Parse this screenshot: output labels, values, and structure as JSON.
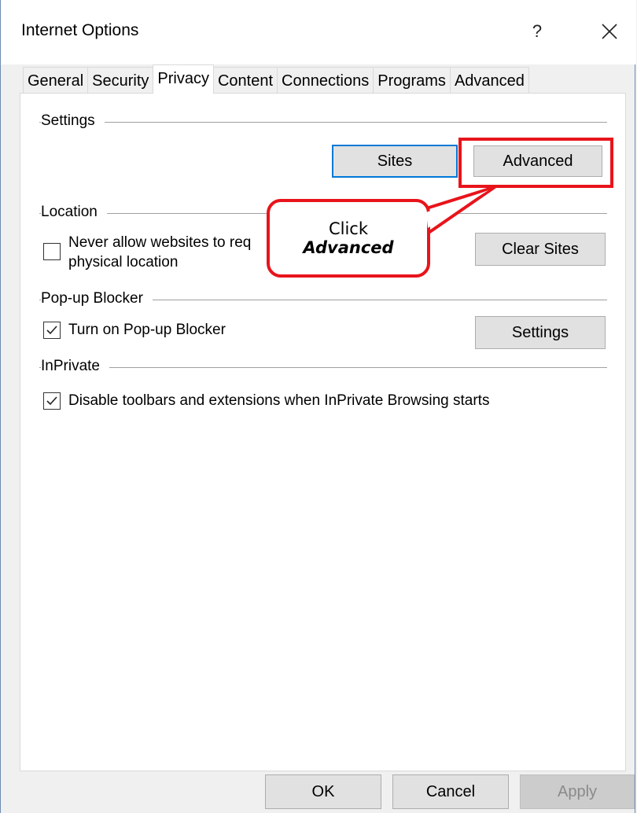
{
  "window": {
    "title": "Internet Options",
    "help_glyph": "?",
    "close_icon": "close-icon"
  },
  "tabs": [
    {
      "label": "General",
      "active": false
    },
    {
      "label": "Security",
      "active": false
    },
    {
      "label": "Privacy",
      "active": true
    },
    {
      "label": "Content",
      "active": false
    },
    {
      "label": "Connections",
      "active": false
    },
    {
      "label": "Programs",
      "active": false
    },
    {
      "label": "Advanced",
      "active": false
    }
  ],
  "settings": {
    "group_label": "Settings",
    "sites_button": "Sites",
    "advanced_button": "Advanced"
  },
  "location": {
    "group_label": "Location",
    "checkbox_line1": "Never allow websites to req",
    "checkbox_line2": "physical location",
    "checked": false,
    "clear_sites_button": "Clear Sites"
  },
  "popup": {
    "group_label": "Pop-up Blocker",
    "checkbox_label": "Turn on Pop-up Blocker",
    "checked": true,
    "settings_button": "Settings"
  },
  "inprivate": {
    "group_label": "InPrivate",
    "checkbox_label": "Disable toolbars and extensions when InPrivate Browsing starts",
    "checked": true
  },
  "callout": {
    "line1": "Click",
    "line2": "Advanced",
    "color": "#e8141b"
  },
  "footer": {
    "ok": "OK",
    "cancel": "Cancel",
    "apply": "Apply"
  }
}
